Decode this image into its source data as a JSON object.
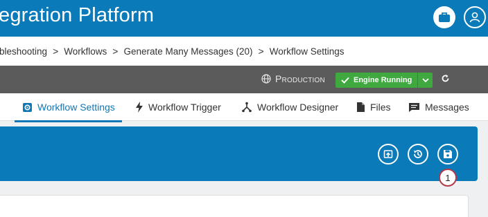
{
  "header": {
    "title": "egration Platform"
  },
  "breadcrumb": {
    "items": [
      "bleshooting",
      "Workflows",
      "Generate Many Messages (20)",
      "Workflow Settings"
    ],
    "separator": ">"
  },
  "env": {
    "label": "Production",
    "engine_status": "Engine Running"
  },
  "tabs": [
    {
      "label": "Workflow Settings",
      "icon": "gear-icon",
      "active": true
    },
    {
      "label": "Workflow Trigger",
      "icon": "lightning-icon"
    },
    {
      "label": "Workflow Designer",
      "icon": "fork-icon"
    },
    {
      "label": "Files",
      "icon": "file-icon"
    },
    {
      "label": "Messages",
      "icon": "message-icon"
    }
  ],
  "panel": {
    "buttons": [
      "export-icon",
      "history-icon",
      "save-icon"
    ],
    "annotation": "1"
  },
  "colors": {
    "header": "#0a7ab8",
    "env_bar": "#5b5b5b",
    "engine": "#3fa83f",
    "active_tab": "#1177b5"
  }
}
